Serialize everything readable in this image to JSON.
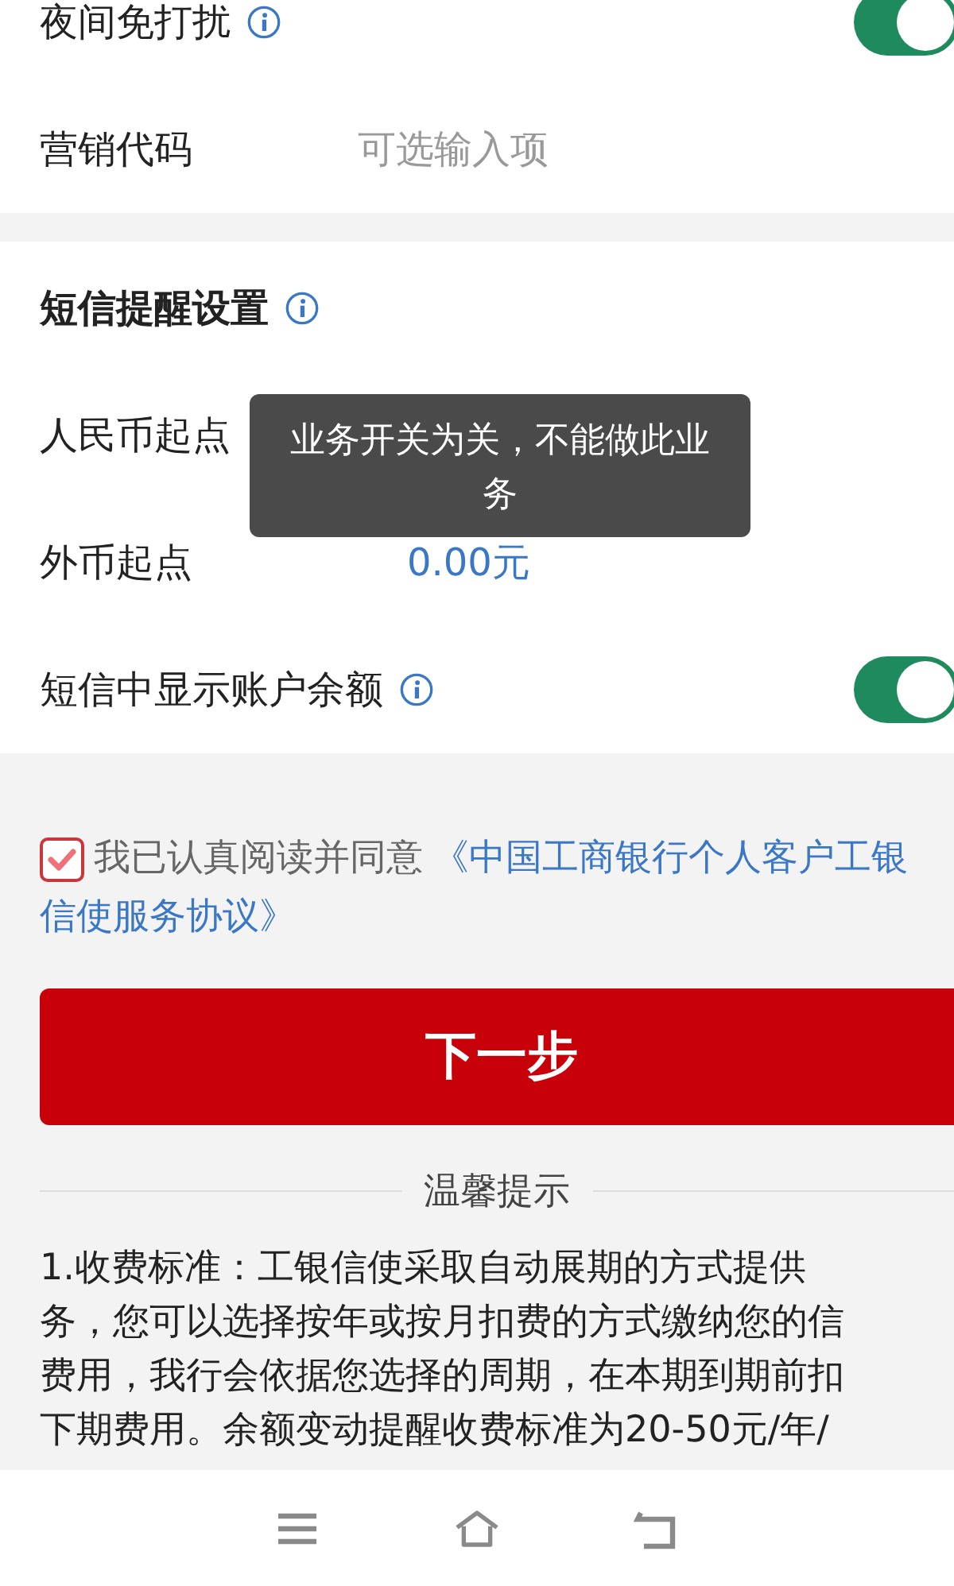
{
  "settings": [
    {
      "kind": "toggle",
      "label": "夜间免打扰",
      "info": true,
      "on": true
    },
    {
      "kind": "input",
      "label": "营销代码",
      "placeholder": "可选输入项"
    }
  ],
  "sms_section": {
    "title": "短信提醒设置",
    "info": true,
    "rows": [
      {
        "kind": "amount",
        "label": "人民币起点"
      },
      {
        "kind": "amount",
        "label": "外币起点",
        "value": "0.00元"
      },
      {
        "kind": "toggle",
        "label": "短信中显示账户余额",
        "info": true,
        "on": true
      }
    ]
  },
  "toast": "业务开关为关，不能做此业务",
  "agreement": {
    "checked": true,
    "text": "我已认真阅读并同意",
    "link_lines": [
      "《中国工商银行个人客户工银",
      "信使服务协议》"
    ]
  },
  "next_button": "下一步",
  "tips": {
    "title": "温馨提示",
    "lines": [
      "1.收费标准：工银信使采取自动展期的方式提供",
      "务，您可以选择按年或按月扣费的方式缴纳您的信",
      "费用，我行会依据您选择的周期，在本期到期前扣",
      "下期费用。余额变动提醒收费标准为20-50元/年/"
    ]
  }
}
